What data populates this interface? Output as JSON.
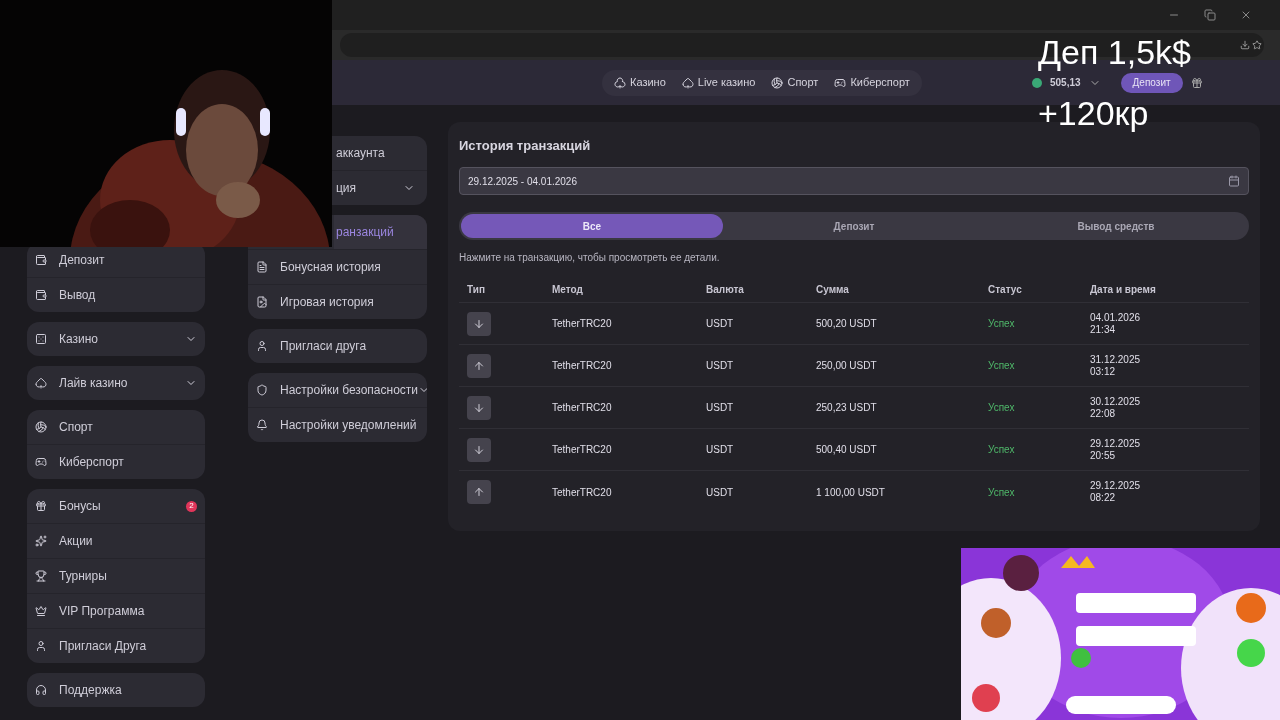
{
  "overlay": {
    "lines": [
      "Деп 1,5k$",
      "+120кр"
    ]
  },
  "header": {
    "nav": [
      {
        "label": "Казино"
      },
      {
        "label": "Live казино"
      },
      {
        "label": "Спорт"
      },
      {
        "label": "Киберспорт"
      }
    ],
    "balance": "505,13",
    "deposit_button": "Депозит"
  },
  "sidebar": {
    "groups": [
      [
        {
          "label": "Депозит",
          "kind": "link"
        },
        {
          "label": "Вывод",
          "kind": "link"
        }
      ],
      [
        {
          "label": "Казино",
          "kind": "dropdown"
        }
      ],
      [
        {
          "label": "Лайв казино",
          "kind": "dropdown"
        }
      ],
      [
        {
          "label": "Спорт",
          "kind": "link"
        },
        {
          "label": "Киберспорт",
          "kind": "link"
        }
      ],
      [
        {
          "label": "Бонусы",
          "kind": "link",
          "badge": "2"
        },
        {
          "label": "Акции",
          "kind": "link"
        },
        {
          "label": "Турниры",
          "kind": "link"
        },
        {
          "label": "VIP Программа",
          "kind": "link"
        },
        {
          "label": "Пригласи Друга",
          "kind": "link"
        }
      ],
      [
        {
          "label": "Поддержка",
          "kind": "link"
        }
      ]
    ]
  },
  "account_menu": {
    "groups": [
      [
        {
          "label": "аккаунта",
          "kind": "covered",
          "selected": false
        },
        {
          "label": "ция",
          "kind": "covered-dropdown",
          "selected": false
        }
      ],
      [
        {
          "label": "ранзакций",
          "kind": "covered",
          "selected": true
        },
        {
          "label": "Бонусная история",
          "kind": "link",
          "selected": false
        },
        {
          "label": "Игровая история",
          "kind": "link",
          "selected": false
        }
      ],
      [
        {
          "label": "Пригласи друга",
          "kind": "link",
          "selected": false
        }
      ],
      [
        {
          "label": "Настройки безопасности",
          "kind": "dropdown",
          "selected": false
        },
        {
          "label": "Настройки уведомлений",
          "kind": "link",
          "selected": false
        }
      ]
    ]
  },
  "transactions": {
    "title": "История транзакций",
    "date_range": "29.12.2025 - 04.01.2026",
    "filters": [
      {
        "label": "Все",
        "selected": true
      },
      {
        "label": "Депозит",
        "selected": false
      },
      {
        "label": "Вывод средств",
        "selected": false
      }
    ],
    "hint": "Нажмите на транзакцию, чтобы просмотреть ее детали.",
    "columns": [
      "Тип",
      "Метод",
      "Валюта",
      "Сумма",
      "Статус",
      "Дата и время"
    ],
    "rows": [
      {
        "kind": "deposit",
        "method": "TetherTRC20",
        "currency": "USDT",
        "amount": "500,20 USDT",
        "status": "Успех",
        "date": "04.01.2026",
        "time": "21:34"
      },
      {
        "kind": "withdrawal",
        "method": "TetherTRC20",
        "currency": "USDT",
        "amount": "250,00 USDT",
        "status": "Успех",
        "date": "31.12.2025",
        "time": "03:12"
      },
      {
        "kind": "deposit",
        "method": "TetherTRC20",
        "currency": "USDT",
        "amount": "250,23 USDT",
        "status": "Успех",
        "date": "30.12.2025",
        "time": "22:08"
      },
      {
        "kind": "deposit",
        "method": "TetherTRC20",
        "currency": "USDT",
        "amount": "500,40 USDT",
        "status": "Успех",
        "date": "29.12.2025",
        "time": "20:55"
      },
      {
        "kind": "withdrawal",
        "method": "TetherTRC20",
        "currency": "USDT",
        "amount": "1 100,00 USDT",
        "status": "Успех",
        "date": "29.12.2025",
        "time": "08:22"
      }
    ]
  }
}
